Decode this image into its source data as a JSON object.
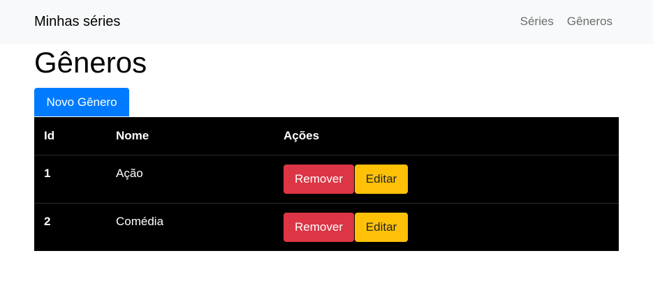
{
  "navbar": {
    "brand": "Minhas séries",
    "links": [
      {
        "label": "Séries"
      },
      {
        "label": "Gêneros"
      }
    ]
  },
  "page": {
    "title": "Gêneros",
    "new_button": "Novo Gênero"
  },
  "table": {
    "headers": [
      "Id",
      "Nome",
      "Ações"
    ],
    "rows": [
      {
        "id": "1",
        "nome": "Ação",
        "remove_label": "Remover",
        "edit_label": "Editar"
      },
      {
        "id": "2",
        "nome": "Comédia",
        "remove_label": "Remover",
        "edit_label": "Editar"
      }
    ]
  },
  "colors": {
    "navbar_bg": "#f8f9fa",
    "primary": "#007bff",
    "danger": "#dc3545",
    "warning": "#ffc107",
    "table_bg": "#000000"
  }
}
